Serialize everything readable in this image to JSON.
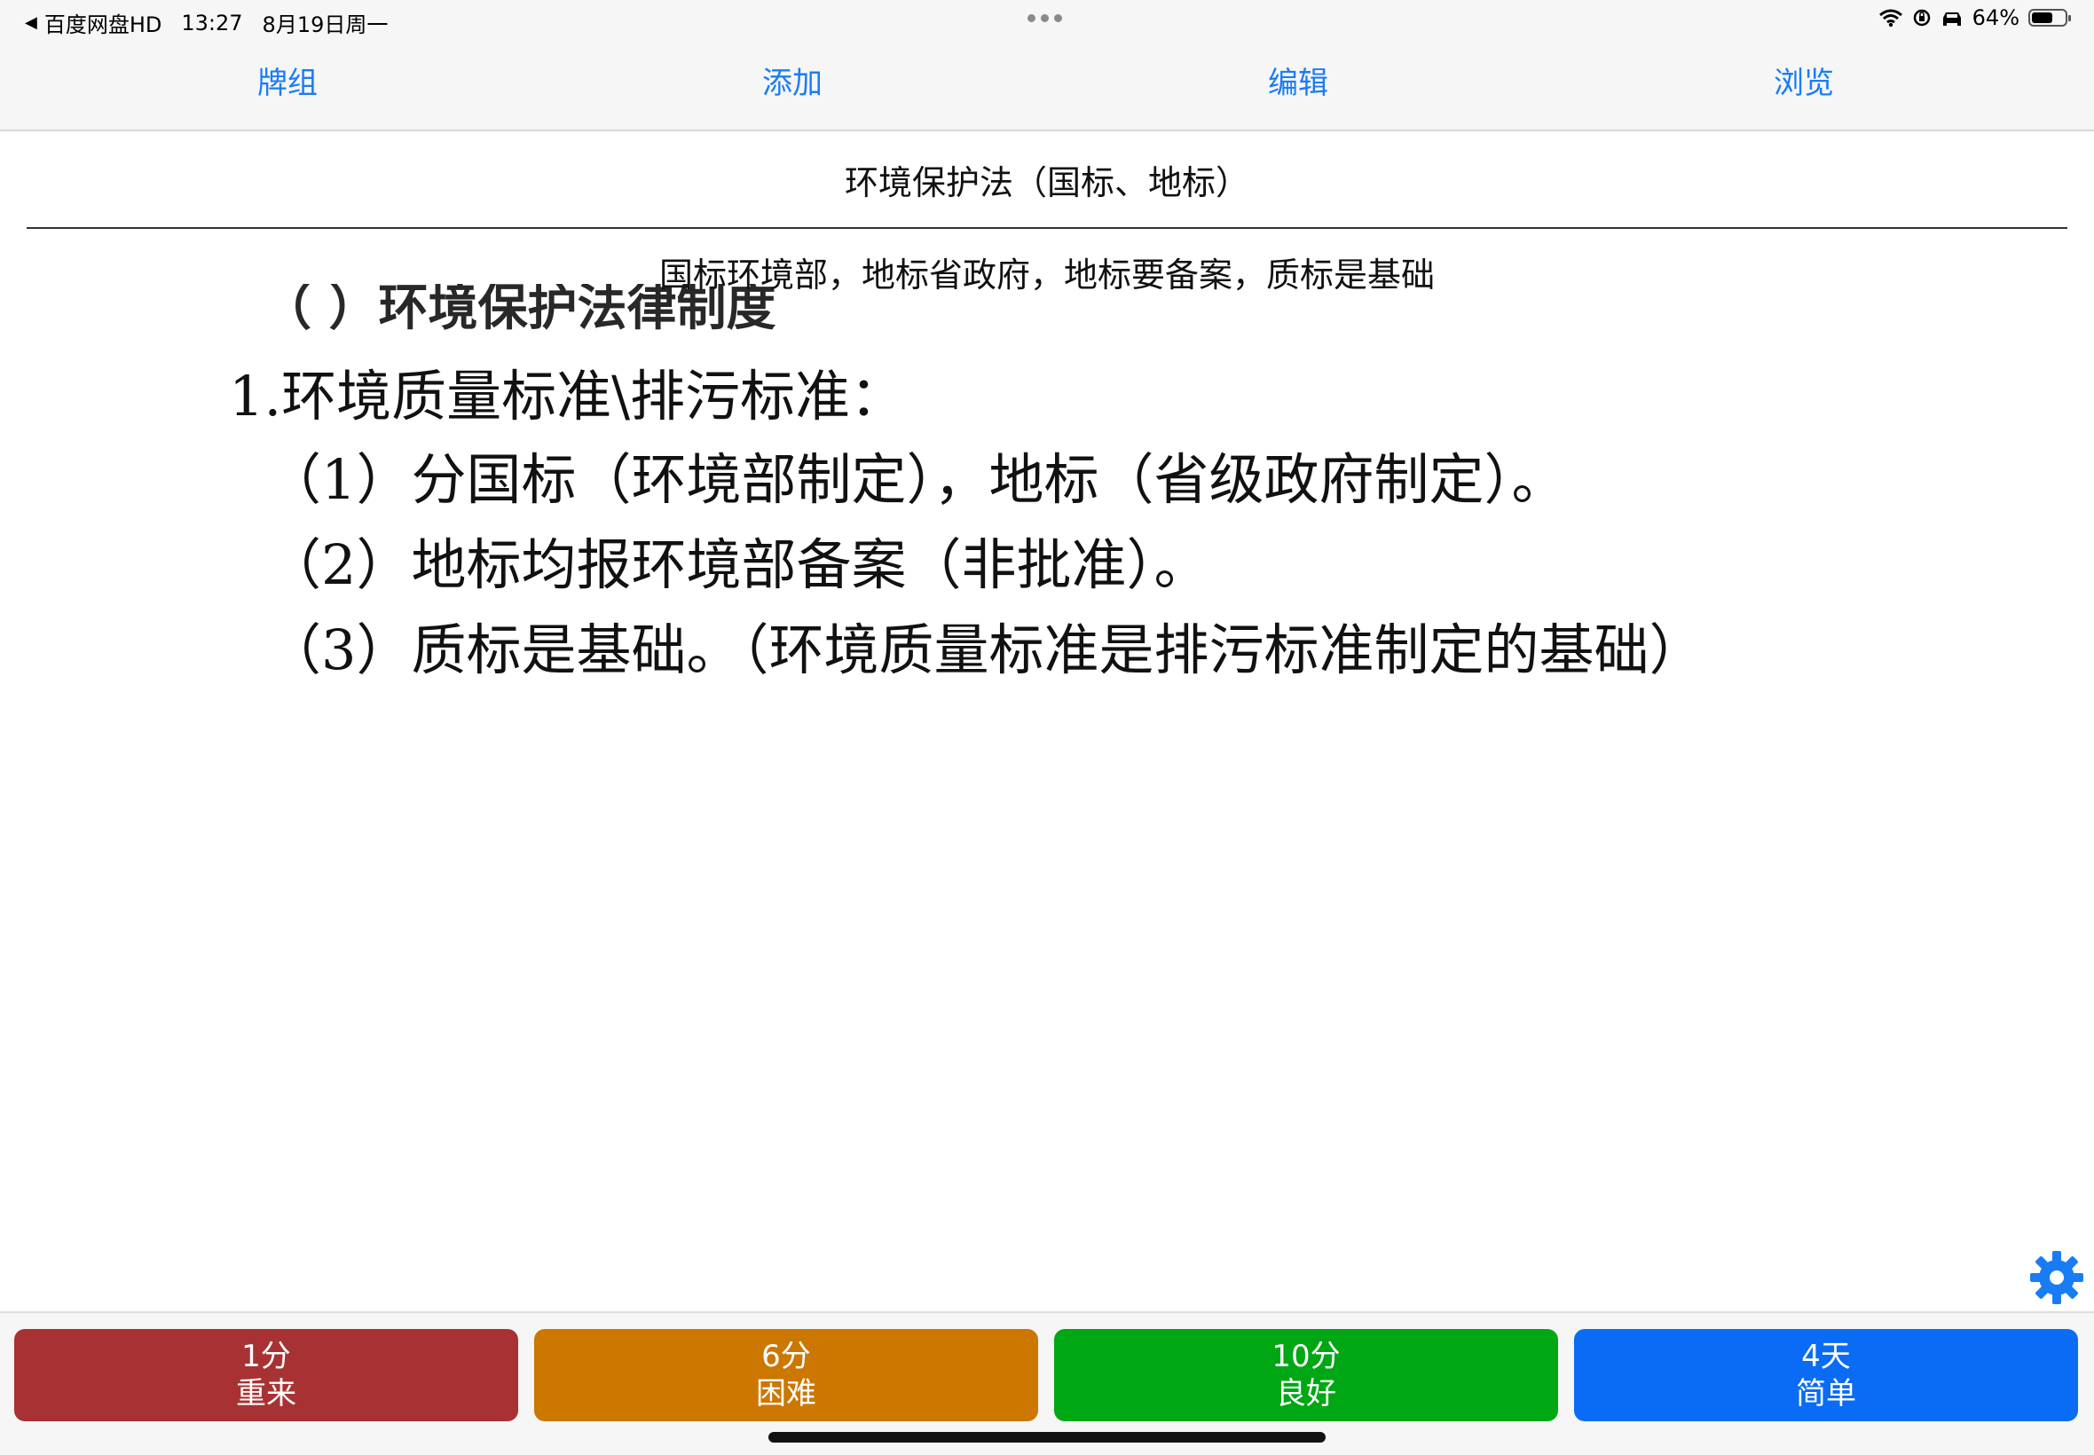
{
  "status": {
    "back_app": "百度网盘HD",
    "time": "13:27",
    "date": "8月19日周一",
    "battery": "64%",
    "battery_level": 0.64
  },
  "nav": {
    "decks": "牌组",
    "add": "添加",
    "edit": "编辑",
    "browse": "浏览"
  },
  "card": {
    "front": "环境保护法（国标、地标）",
    "back": "国标环境部，地标省政府，地标要备案，质标是基础",
    "image_lines": {
      "cut": "（  ）环境保护法律制度",
      "line1": "1.环境质量标准\\排污标准：",
      "line2": "（1）分国标（环境部制定），地标（省级政府制定）。",
      "line3": "（2）地标均报环境部备案（非批准）。",
      "line4": "（3）质标是基础。（环境质量标准是排污标准制定的基础）"
    }
  },
  "answers": [
    {
      "interval": "1分",
      "label": "重来",
      "color": "#a83233"
    },
    {
      "interval": "6分",
      "label": "困难",
      "color": "#cc7700"
    },
    {
      "interval": "10分",
      "label": "良好",
      "color": "#00a714"
    },
    {
      "interval": "4天",
      "label": "简单",
      "color": "#0a6cf5"
    }
  ],
  "icons": {
    "settings": "gear-icon",
    "back": "back-arrow-icon",
    "wifi": "wifi-icon",
    "orientation_lock": "orientation-lock-icon",
    "car": "car-icon",
    "battery": "battery-icon"
  }
}
